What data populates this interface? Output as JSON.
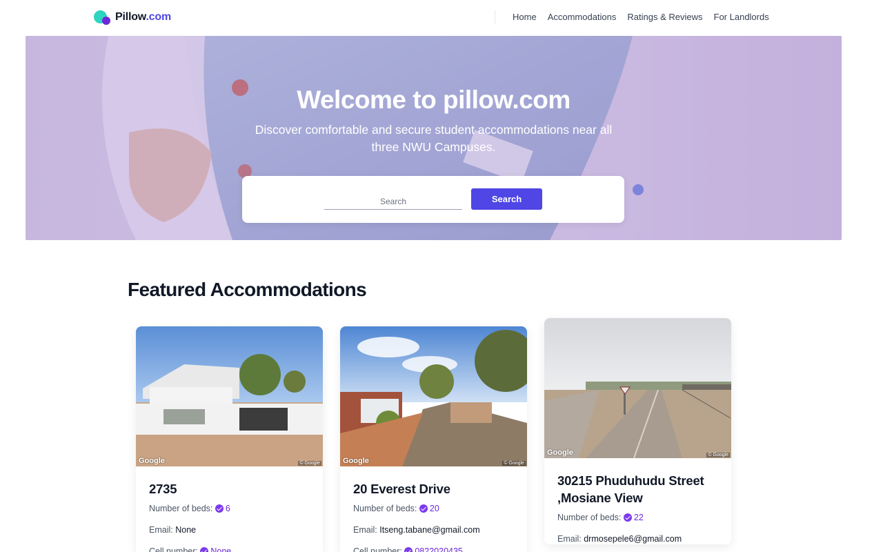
{
  "navbar": {
    "logo_name": "Pillow",
    "logo_tld": ".com",
    "links": [
      "Home",
      "Accommodations",
      "Ratings & Reviews",
      "For Landlords"
    ]
  },
  "hero": {
    "title": "Welcome to pillow.com",
    "subtitle": "Discover comfortable and secure student accommodations near all three NWU Campuses.",
    "search_placeholder": "Search",
    "search_button": "Search"
  },
  "featured": {
    "title": "Featured Accommodations",
    "labels": {
      "beds": "Number of beds:",
      "email": "Email:",
      "cell": "Cell number:"
    },
    "image_credit": "Google",
    "image_copyright": "© Google",
    "cards": [
      {
        "title": "2735",
        "beds": "6",
        "email": "None",
        "cell": "None"
      },
      {
        "title": "20 Everest Drive",
        "beds": "20",
        "email": "Itseng.tabane@gmail.com",
        "cell": "0822020435"
      },
      {
        "title": "30215 Phuduhudu Street ,Mosiane View",
        "beds": "22",
        "email": "drmosepele6@gmail.com",
        "cell": ""
      }
    ]
  },
  "colors": {
    "accent": "#4f46e5",
    "check": "#7c3aed",
    "logo_teal": "#2dd4bf"
  }
}
